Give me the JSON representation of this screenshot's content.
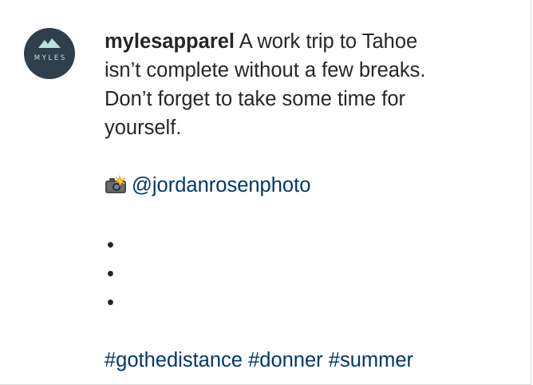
{
  "post": {
    "avatar_text": "MYLES",
    "username": "mylesapparel",
    "caption_lines": [
      "A work trip to Tahoe",
      "isn’t complete without a few breaks.",
      "Don’t forget to take some time for",
      "yourself."
    ],
    "camera_icon": "camera-with-flash-icon",
    "mention": "@jordanrosenphoto",
    "dots": [
      "•",
      "•",
      "•"
    ],
    "hashtags": [
      "#gothedistance",
      "#donner",
      "#summer"
    ]
  },
  "colors": {
    "text": "#262626",
    "link": "#00376b",
    "avatar_bg": "#2f3f4c",
    "avatar_accent": "#b9e3e0",
    "border": "#dbdbdb"
  }
}
